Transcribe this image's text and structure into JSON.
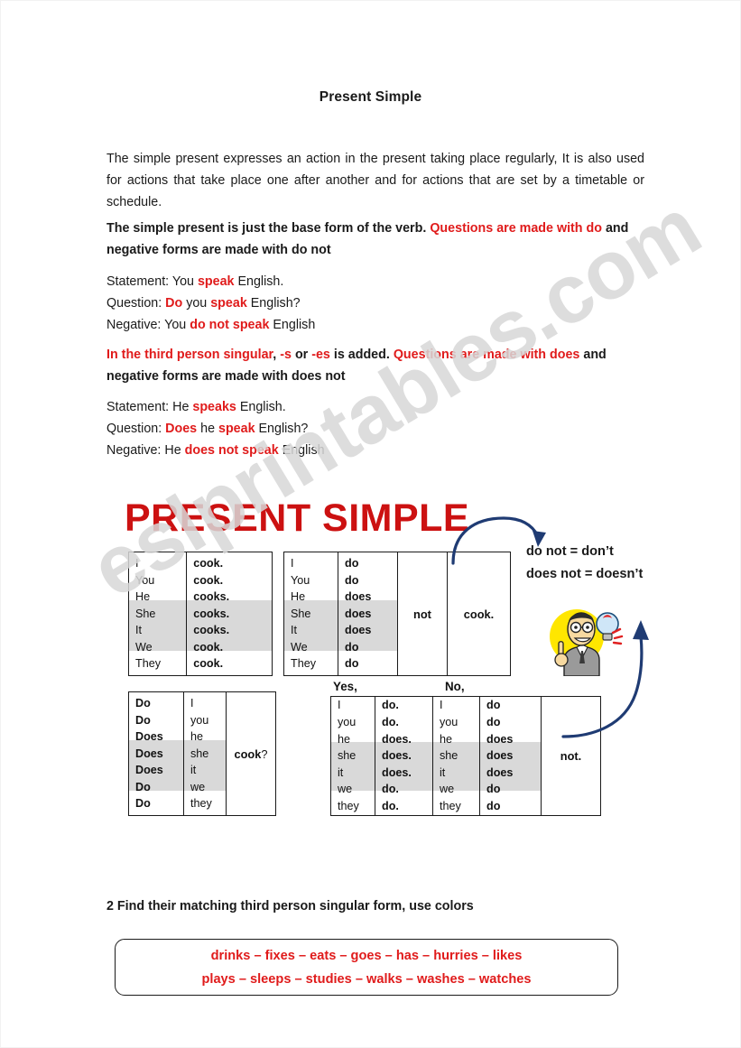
{
  "document": {
    "title": "Present Simple",
    "watermark": "eslprintables.com",
    "banner": "PRESENT SIMPLE"
  },
  "intro": {
    "text": "The simple present expresses an action in the present taking place regularly, It is also used for actions that take place one after another and for actions that are set by a timetable or schedule."
  },
  "rule_base": {
    "black_part": "The simple present is just the base form of the verb. ",
    "red_part": "Questions are made with do",
    "black_part2": " and negative forms are made with do not"
  },
  "examples_base": {
    "statement": {
      "label": "Statement: ",
      "pre": "You ",
      "red": "speak",
      "post": " English."
    },
    "question": {
      "label": "Question: ",
      "red1": "Do",
      "mid": " you ",
      "red2": "speak",
      "post": " English?"
    },
    "negative": {
      "label": "Negative: ",
      "pre": "You ",
      "red": "do not speak",
      "post": " English"
    }
  },
  "rule_third": {
    "red_part": "In the third person singular",
    "black_sep": ", ",
    "red_s": "-s",
    "black_or": " or ",
    "red_es": "-es",
    "black_added": " is added. ",
    "red_part2": "Questions are made with does",
    "black_part2": " and negative forms are made with does not"
  },
  "examples_third": {
    "statement": {
      "label": "Statement: ",
      "pre": "He ",
      "red": "speaks",
      "post": " English."
    },
    "question": {
      "label": "Question: ",
      "red1": "Does",
      "mid": " he ",
      "red2": "speak",
      "post": " English?"
    },
    "negative": {
      "label": "Negative: ",
      "pre": "He ",
      "red": "does not speak",
      "post": " English"
    }
  },
  "tables": {
    "affirmative": {
      "subjects": [
        "I",
        "You",
        "He",
        "She",
        "It",
        "We",
        "They"
      ],
      "verbs": [
        "cook.",
        "cook.",
        "cooks.",
        "cooks.",
        "cooks.",
        "cook.",
        "cook."
      ]
    },
    "negative": {
      "subjects": [
        "I",
        "You",
        "He",
        "She",
        "It",
        "We",
        "They"
      ],
      "auxiliaries": [
        "do",
        "do",
        "does",
        "does",
        "does",
        "do",
        "do"
      ],
      "not": "not",
      "verb": "cook."
    },
    "question": {
      "auxiliaries": [
        "Do",
        "Do",
        "Does",
        "Does",
        "Does",
        "Do",
        "Do"
      ],
      "subjects": [
        "I",
        "you",
        "he",
        "she",
        "it",
        "we",
        "they"
      ],
      "verb_pre": "cook",
      "verb_mark": "?"
    },
    "short_answers": {
      "yes_label": "Yes,",
      "no_label": "No,",
      "yes_subjects": [
        "I",
        "you",
        "he",
        "she",
        "it",
        "we",
        "they"
      ],
      "yes_auxiliaries": [
        "do.",
        "do.",
        "does.",
        "does.",
        "does.",
        "do.",
        "do."
      ],
      "no_subjects": [
        "I",
        "you",
        "he",
        "she",
        "it",
        "we",
        "they"
      ],
      "no_auxiliaries": [
        "do",
        "do",
        "does",
        "does",
        "does",
        "do",
        "do"
      ],
      "not": "not."
    }
  },
  "notes": {
    "line1": "do not = don’t",
    "line2": "does not = doesn’t"
  },
  "exercise": {
    "heading": "2 Find their matching third person singular form, use colors",
    "words_line1": "drinks – fixes –  eats –  goes – has – hurries – likes",
    "words_line2": "plays – sleeps –  studies – walks – washes – watches"
  },
  "colors": {
    "red_text": "#e01b1b",
    "banner_red": "#cc1111",
    "arrow_blue": "#1f3b73",
    "shade_gray": "#d9d9d9",
    "bulb_yellow": "#ffe600"
  }
}
